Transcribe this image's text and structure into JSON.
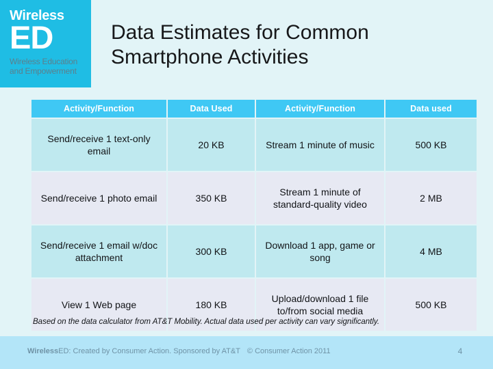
{
  "slide": {
    "background_color": "#e2f4f7",
    "title": "Data Estimates for Common Smartphone Activities"
  },
  "logo": {
    "background_color": "#1fbde4",
    "top_word": "Wireless",
    "big_word": "ED",
    "tagline_line1": "Wireless Education",
    "tagline_line2": "and Empowerment"
  },
  "table": {
    "header_color": "#3fc8f4",
    "row_odd_color": "#bfe9ef",
    "row_even_color": "#e7e9f3",
    "headers": [
      "Activity/Function",
      "Data Used",
      "Activity/Function",
      "Data used"
    ],
    "rows": [
      {
        "activity_left": "Send/receive 1 text-only email",
        "data_left": "20 KB",
        "activity_right": "Stream 1 minute of music",
        "data_right": "500 KB"
      },
      {
        "activity_left": "Send/receive 1 photo email",
        "data_left": "350 KB",
        "activity_right": "Stream 1 minute of standard-quality video",
        "data_right": "2 MB"
      },
      {
        "activity_left": "Send/receive 1 email w/doc attachment",
        "data_left": "300 KB",
        "activity_right": "Download 1 app, game or song",
        "data_right": "4 MB"
      },
      {
        "activity_left": "View 1 Web page",
        "data_left": "180 KB",
        "activity_right": "Upload/download 1 file to/from social media",
        "data_right": "500 KB"
      }
    ]
  },
  "footnote": "Based on the data calculator from AT&T Mobility.  Actual data used per activity can vary significantly.",
  "footer": {
    "background_color": "#b3e5f8",
    "credit_bold": "Wireless",
    "credit_rest": "ED: Created by Consumer Action. Sponsored by AT&T",
    "copyright": "© Consumer Action 2011",
    "page_number": "4"
  }
}
